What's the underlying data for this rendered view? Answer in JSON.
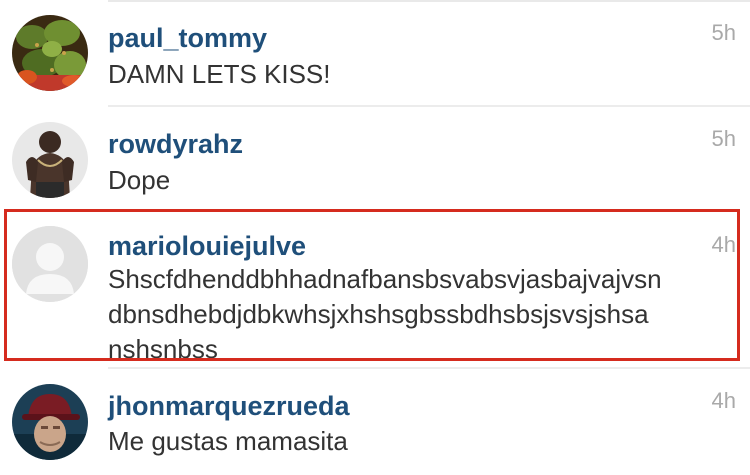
{
  "comments": [
    {
      "username": "paul_tommy",
      "time": "5h",
      "text": "DAMN LETS KISS!",
      "avatar_icon": "food-photo-avatar-icon"
    },
    {
      "username": "rowdyrahz",
      "time": "5h",
      "text": "Dope",
      "avatar_icon": "person-photo-avatar-icon"
    },
    {
      "username": "mariolouiejulve",
      "time": "4h",
      "text_lines": [
        "Shscfdhenddbhhadnafbansbsvabsvjasbajvajvsn",
        "dbnsdhebdjdbkwhsjxhshsgbssbdhsbsjsvsjshsa",
        "nshsnbss"
      ],
      "avatar_icon": "default-user-avatar-icon",
      "highlighted": true
    },
    {
      "username": "jhonmarquezrueda",
      "time": "4h",
      "text": "Me gustas  mamasita",
      "avatar_icon": "person-cap-avatar-icon"
    }
  ],
  "colors": {
    "username": "#1f4f7a",
    "time": "#a9a9a9",
    "highlight_border": "#d52b1e"
  }
}
